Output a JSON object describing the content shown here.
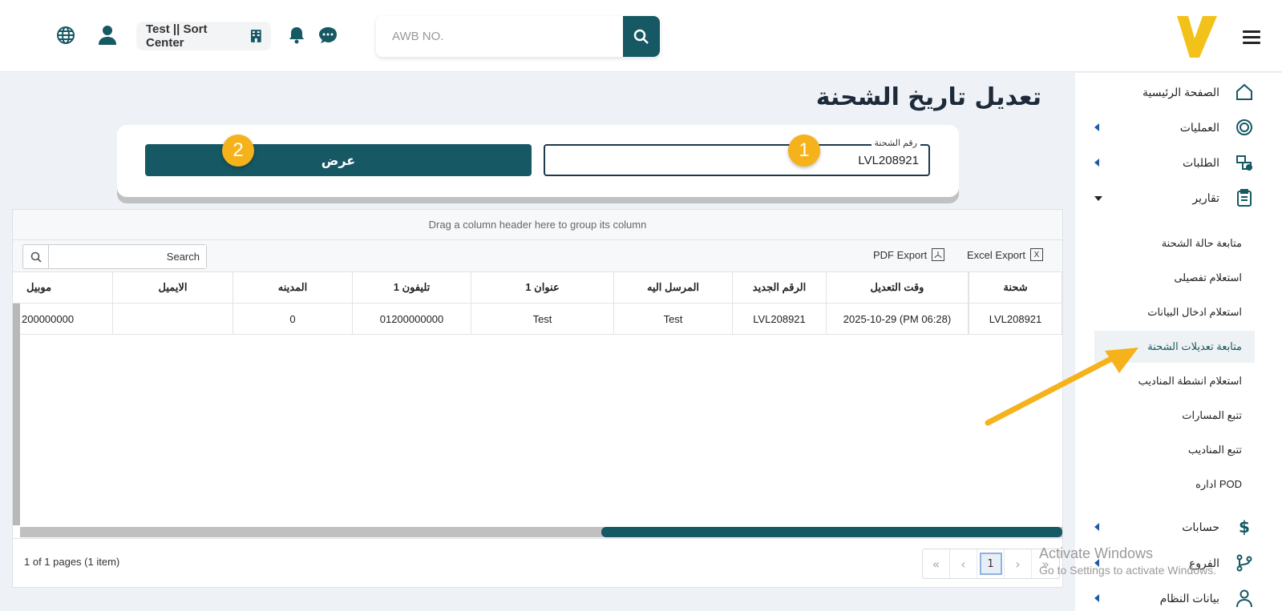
{
  "header": {
    "building_label": "Test || Sort Center",
    "search_placeholder": "AWB NO."
  },
  "sidebar": {
    "items": [
      {
        "label": "الصفحة الرئيسية",
        "icon": "home-icon"
      },
      {
        "label": "العمليات",
        "icon": "new-badge-icon"
      },
      {
        "label": "الطلبات",
        "icon": "boxes-icon"
      },
      {
        "label": "تقارير",
        "icon": "clipboard-icon"
      }
    ],
    "sub_items": [
      "متابعة حالة الشحنة",
      "استعلام تفصيلى",
      "استعلام ادخال البيانات",
      "متابعة تعديلات الشحنة",
      "استعلام انشطة المناديب",
      "تتبع المسارات",
      "تتبع المناديب",
      "اداره POD"
    ],
    "bottom_items": [
      {
        "label": "حسابات",
        "icon": "dollar-icon"
      },
      {
        "label": "الفروع",
        "icon": "branch-icon"
      },
      {
        "label": "بيانات النظام",
        "icon": "user-icon"
      }
    ]
  },
  "page": {
    "title": "تعديل تاريخ الشحنة",
    "field_label": "رقم الشحنة",
    "field_value": "LVL208921",
    "show_button": "عرض",
    "badge_1": "1",
    "badge_2": "2"
  },
  "grid": {
    "group_hint": "Drag a column header here to group its column",
    "search_placeholder": "Search",
    "excel_export": "Excel Export",
    "pdf_export": "PDF Export",
    "columns": [
      "شحنة",
      "وقت التعديل",
      "الرقم الجديد",
      "المرسل اليه",
      "1 عنوان",
      "1 تليفون",
      "المدينه",
      "الايميل",
      "موبيل"
    ],
    "rows": [
      [
        "LVL208921",
        "2025-10-29 (PM 06:28)",
        "LVL208921",
        "Test",
        "Test",
        "01200000000",
        "0",
        "",
        "200000000"
      ]
    ],
    "pager_info": "1 of 1 pages (1 item)",
    "current_page": "1"
  },
  "watermark": {
    "line1": "Activate Windows",
    "line2": "Go to Settings to activate Windows."
  },
  "colors": {
    "primary": "#165863",
    "accent": "#f5b21b",
    "logo": "#f2c21b"
  }
}
